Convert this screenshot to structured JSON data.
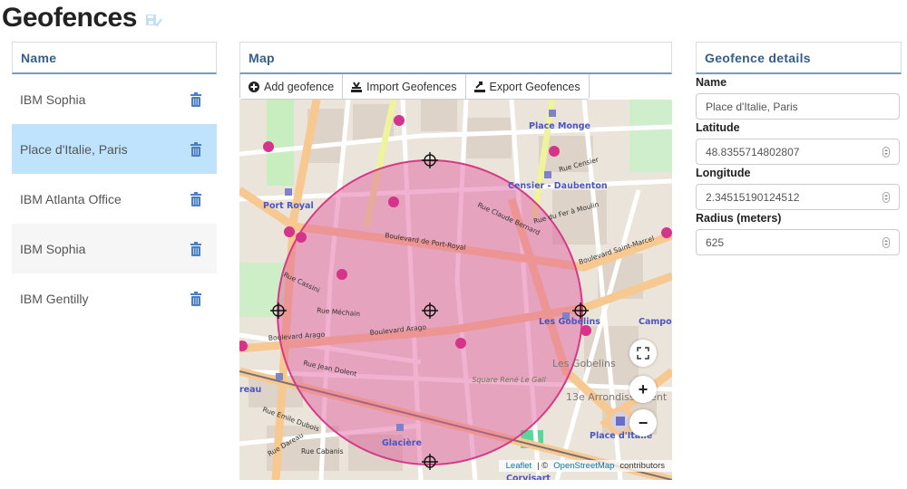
{
  "page": {
    "title": "Geofences"
  },
  "name_panel": {
    "header": "Name",
    "items": [
      {
        "label": "IBM Sophia",
        "state": "normal"
      },
      {
        "label": "Place d'Italie, Paris",
        "state": "selected"
      },
      {
        "label": "IBM Atlanta Office",
        "state": "normal"
      },
      {
        "label": "IBM Sophia",
        "state": "hover"
      },
      {
        "label": "IBM Gentilly",
        "state": "normal"
      }
    ]
  },
  "map_panel": {
    "header": "Map",
    "toolbar": {
      "add_label": "Add geofence",
      "import_label": "Import Geofences",
      "export_label": "Export Geofences"
    },
    "controls": {
      "fullscreen": "fullscreen-icon",
      "zoom_in": "+",
      "zoom_out": "−"
    },
    "attribution": {
      "leaflet": "Leaflet",
      "sep": "| ©",
      "osm": "OpenStreetMap",
      "contributors": "contributors"
    },
    "labels": {
      "port_royal": "Port Royal",
      "place_monge": "Place Monge",
      "censier": "Censier - Daubenton",
      "bd_port_royal": "Boulevard de Port-Royal",
      "bd_arago_1": "Boulevard Arago",
      "bd_arago_2": "Boulevard Arago",
      "les_gobelins_station": "Les Gobelins",
      "les_gobelins_area": "Les Gobelins",
      "arrondissement": "13e Arrondissement",
      "square": "Square René Le Gall",
      "place_italie": "Place d'Italie",
      "glaciere": "Glacière",
      "corvisart": "Corvisart",
      "campo": "Campo-",
      "reau": "reau",
      "bd_st_marcel": "Boulevard Saint-Marcel",
      "rue_claude_bernard": "Rue Claude Bernard",
      "rue_mechain": "Rue Méchain",
      "rue_censier": "Rue Censier",
      "rue_fer_moulin": "Rue du Fer à Moulin",
      "rue_cabanis": "Rue Cabanis",
      "rue_dareau": "Rue Dareau",
      "rue_emile_dubois": "Rue Emile Dubois",
      "rue_jean_dolent": "Rue Jean Dolent",
      "rue_cassini": "Rue Cassini"
    },
    "geofence": {
      "radius_meters": 625,
      "fill": "#e0559a",
      "stroke": "#d63a86"
    }
  },
  "details_panel": {
    "header": "Geofence details",
    "name_label": "Name",
    "name_value": "Place d'Italie, Paris",
    "latitude_label": "Latitude",
    "latitude_value": "48.8355714802807",
    "longitude_label": "Longitude",
    "longitude_value": "2.34515190124512",
    "radius_label": "Radius (meters)",
    "radius_value": "625"
  },
  "colors": {
    "header_text": "#355e8a",
    "selected_row": "#bfe3fc",
    "trash_icon": "#4a7fc1"
  }
}
